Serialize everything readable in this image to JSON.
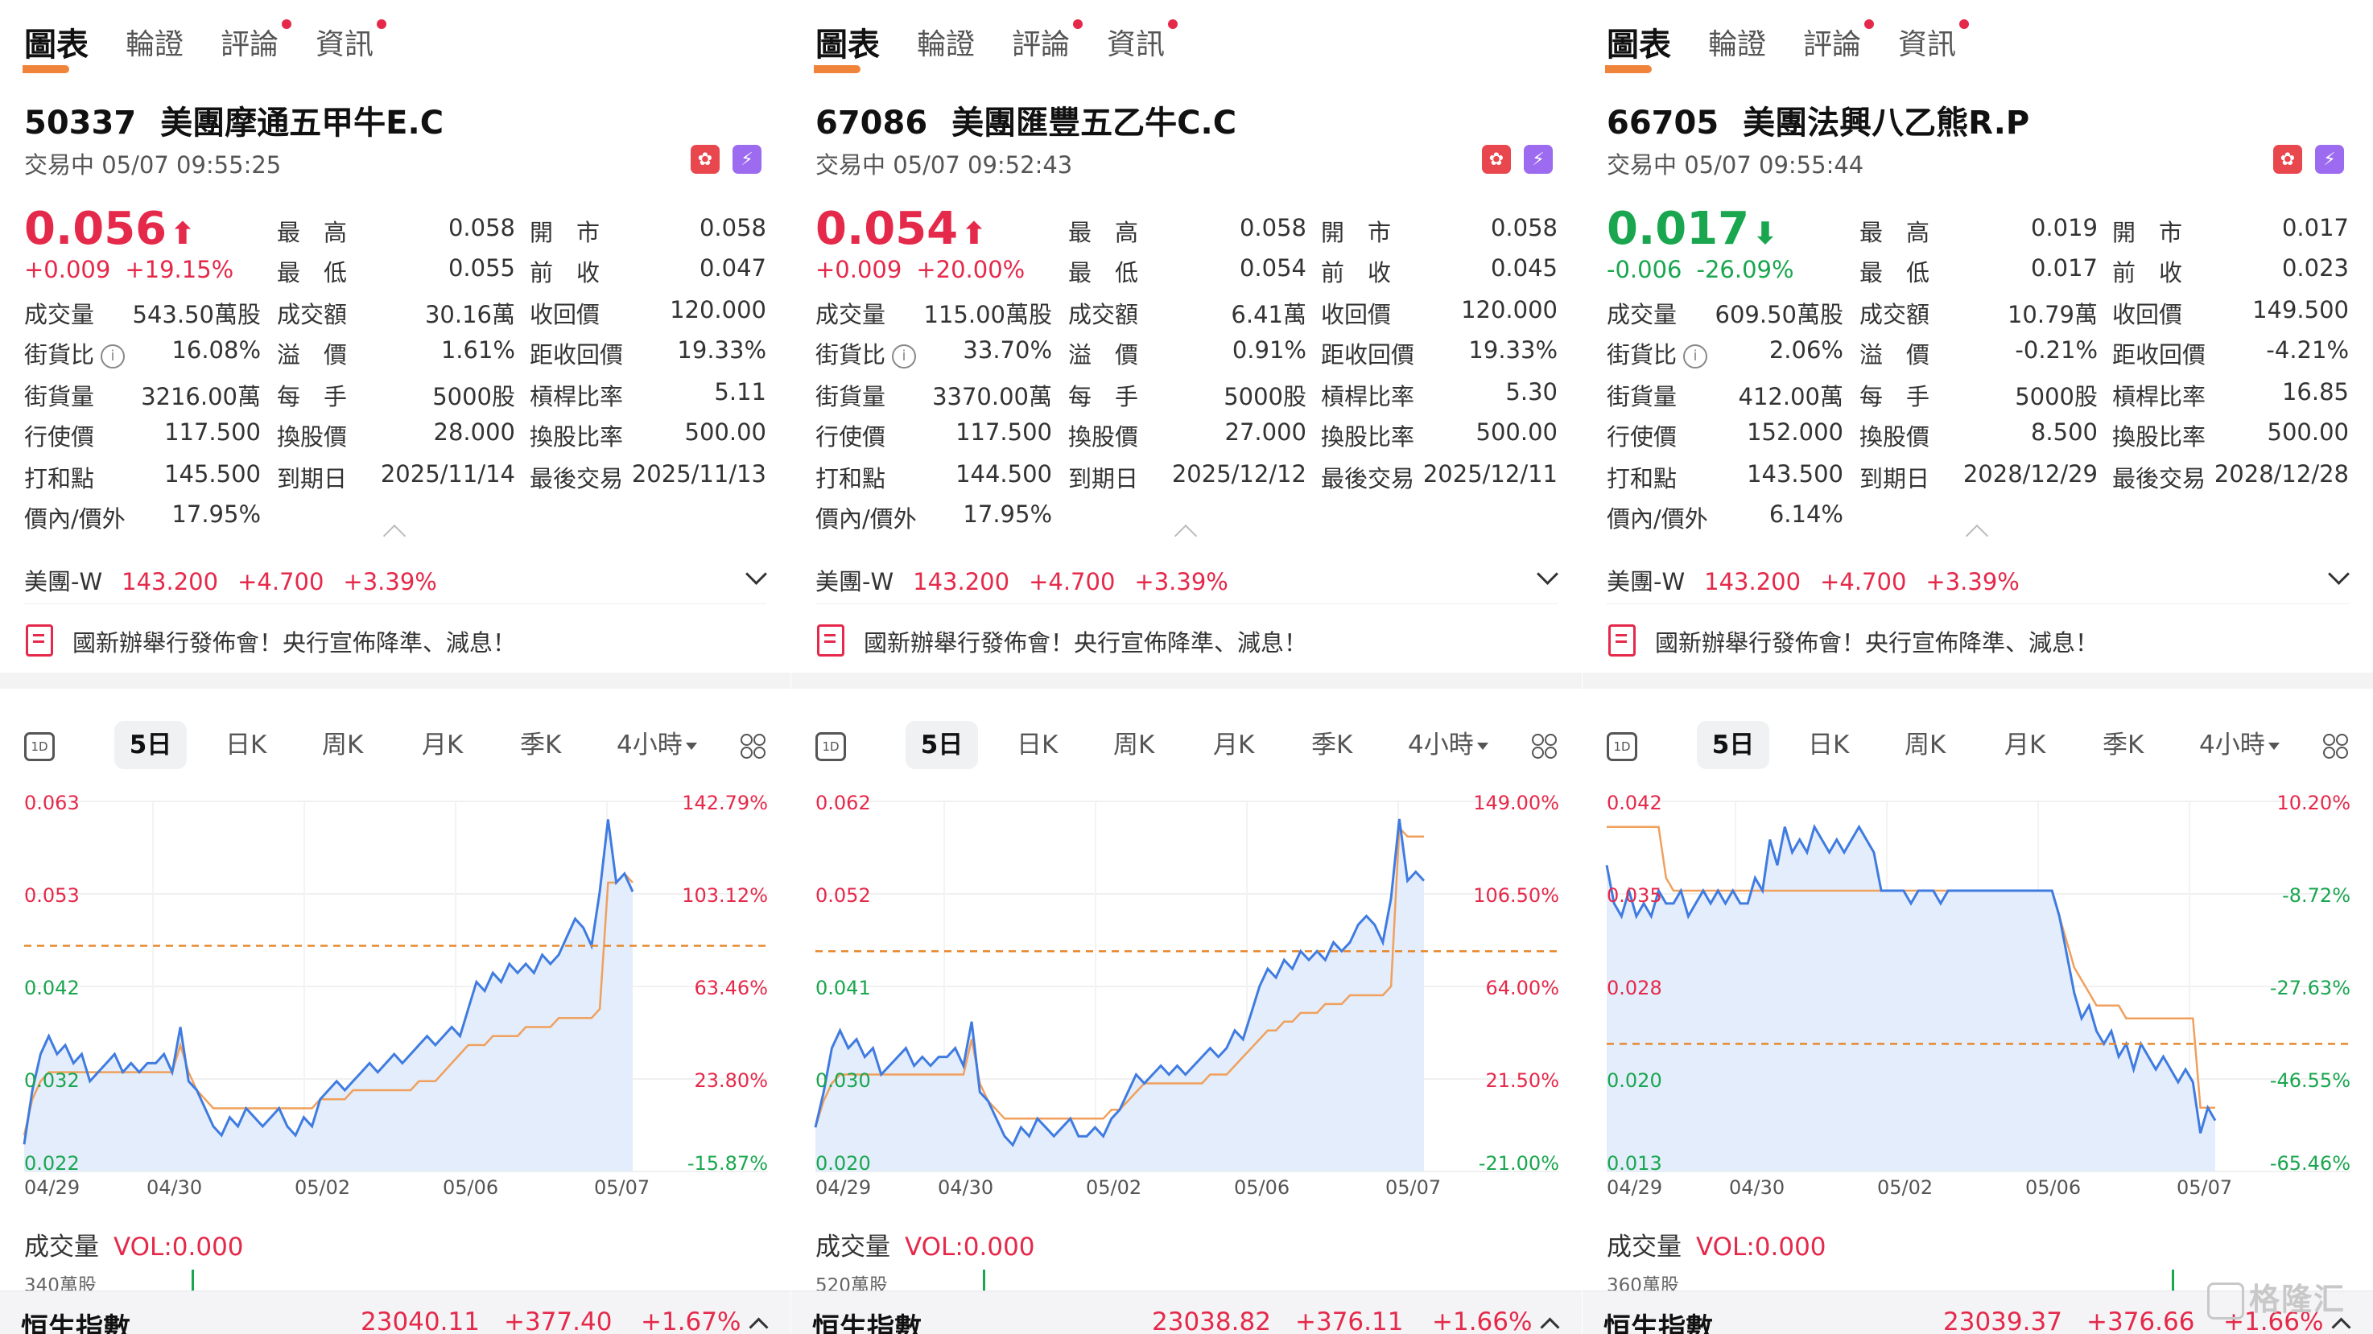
{
  "nav_tabs": [
    "圖表",
    "輪證",
    "評論",
    "資訊"
  ],
  "period_tabs": [
    "5日",
    "日K",
    "周K",
    "月K",
    "季K",
    "4小時"
  ],
  "day_icon_label": "1D",
  "underlying": {
    "name": "美團-W",
    "price": "143.200",
    "change": "+4.700",
    "pct": "+3.39%"
  },
  "news_text": "國新辦舉行發佈會！央行宣佈降準、減息！",
  "volume_label": "成交量",
  "volume_value": "VOL:0.000",
  "index": {
    "name": "恒生指數"
  },
  "watermark": "格隆汇",
  "x_axis_labels": [
    "04/29",
    "04/30",
    "05/02",
    "05/06",
    "05/07"
  ],
  "row_labels": [
    "成交量",
    "街貨比",
    "街貨量",
    "行使價",
    "打和點",
    "價內/價外"
  ],
  "mid_labels": [
    "最　高",
    "最　低",
    "成交額",
    "溢　價",
    "每　手",
    "換股價",
    "到期日"
  ],
  "right_labels": [
    "開　市",
    "前　收",
    "收回價",
    "距收回價",
    "槓桿比率",
    "換股比率",
    "最後交易"
  ],
  "panels": [
    {
      "code": "50337",
      "name": "美團摩通五甲牛E.C",
      "status": "交易中 05/07 09:55:25",
      "price": "0.056",
      "arrow": "⬆",
      "direction": "up",
      "change": "+0.009",
      "change_pct": "+19.15%",
      "high": "0.058",
      "low": "0.055",
      "open": "0.058",
      "prev_close": "0.047",
      "volume": "543.50萬股",
      "turnover": "30.16萬",
      "call_price": "120.000",
      "outstanding_ratio": "16.08%",
      "premium": "1.61%",
      "to_call": "19.33%",
      "outstanding_qty": "3216.00萬",
      "lot": "5000股",
      "leverage": "5.11",
      "strike": "117.500",
      "conv_price": "28.000",
      "conv_ratio": "500.00",
      "breakeven": "145.500",
      "expiry": "2025/11/14",
      "last_trade": "2025/11/13",
      "moneyness": "17.95%",
      "vol_scale": "340萬股",
      "index_value": "23040.11",
      "index_change": "+377.40",
      "index_pct": "+1.67%",
      "chart_data": {
        "type": "line",
        "y_left_labels": [
          "0.063",
          "0.053",
          "0.042",
          "0.032",
          "0.022"
        ],
        "y_right_labels": [
          "142.79%",
          "103.12%",
          "63.46%",
          "23.80%",
          "-15.87%"
        ],
        "ylim": [
          0.022,
          0.063
        ],
        "prev_close": 0.047,
        "price": [
          0.025,
          0.031,
          0.035,
          0.037,
          0.035,
          0.036,
          0.034,
          0.035,
          0.032,
          0.033,
          0.034,
          0.035,
          0.033,
          0.034,
          0.033,
          0.034,
          0.034,
          0.035,
          0.033,
          0.038,
          0.032,
          0.031,
          0.029,
          0.027,
          0.026,
          0.028,
          0.027,
          0.029,
          0.028,
          0.027,
          0.028,
          0.029,
          0.027,
          0.026,
          0.028,
          0.027,
          0.03,
          0.031,
          0.032,
          0.031,
          0.032,
          0.033,
          0.034,
          0.033,
          0.034,
          0.035,
          0.034,
          0.035,
          0.036,
          0.037,
          0.036,
          0.037,
          0.038,
          0.037,
          0.04,
          0.043,
          0.042,
          0.044,
          0.043,
          0.045,
          0.044,
          0.045,
          0.044,
          0.046,
          0.045,
          0.046,
          0.048,
          0.05,
          0.049,
          0.047,
          0.053,
          0.061,
          0.054,
          0.055,
          0.053
        ],
        "avg": [
          0.026,
          0.03,
          0.032,
          0.033,
          0.033,
          0.033,
          0.033,
          0.033,
          0.033,
          0.033,
          0.033,
          0.033,
          0.033,
          0.033,
          0.033,
          0.033,
          0.033,
          0.033,
          0.033,
          0.036,
          0.033,
          0.031,
          0.03,
          0.029,
          0.029,
          0.029,
          0.029,
          0.029,
          0.029,
          0.029,
          0.029,
          0.029,
          0.029,
          0.029,
          0.029,
          0.029,
          0.03,
          0.03,
          0.03,
          0.03,
          0.031,
          0.031,
          0.031,
          0.031,
          0.031,
          0.031,
          0.031,
          0.031,
          0.032,
          0.032,
          0.032,
          0.033,
          0.034,
          0.035,
          0.036,
          0.036,
          0.036,
          0.037,
          0.037,
          0.037,
          0.037,
          0.038,
          0.038,
          0.038,
          0.038,
          0.039,
          0.039,
          0.039,
          0.039,
          0.039,
          0.04,
          0.054,
          0.054,
          0.055,
          0.054
        ]
      }
    },
    {
      "code": "67086",
      "name": "美團匯豐五乙牛C.C",
      "status": "交易中 05/07 09:52:43",
      "price": "0.054",
      "arrow": "⬆",
      "direction": "up",
      "change": "+0.009",
      "change_pct": "+20.00%",
      "high": "0.058",
      "low": "0.054",
      "open": "0.058",
      "prev_close": "0.045",
      "volume": "115.00萬股",
      "turnover": "6.41萬",
      "call_price": "120.000",
      "outstanding_ratio": "33.70%",
      "premium": "0.91%",
      "to_call": "19.33%",
      "outstanding_qty": "3370.00萬",
      "lot": "5000股",
      "leverage": "5.30",
      "strike": "117.500",
      "conv_price": "27.000",
      "conv_ratio": "500.00",
      "breakeven": "144.500",
      "expiry": "2025/12/12",
      "last_trade": "2025/12/11",
      "moneyness": "17.95%",
      "vol_scale": "520萬股",
      "index_value": "23038.82",
      "index_change": "+376.11",
      "index_pct": "+1.66%",
      "chart_data": {
        "type": "line",
        "y_left_labels": [
          "0.062",
          "0.052",
          "0.041",
          "0.030",
          "0.020"
        ],
        "y_right_labels": [
          "149.00%",
          "106.50%",
          "64.00%",
          "21.50%",
          "-21.00%"
        ],
        "ylim": [
          0.02,
          0.062
        ],
        "prev_close": 0.045,
        "price": [
          0.025,
          0.029,
          0.034,
          0.036,
          0.034,
          0.035,
          0.033,
          0.034,
          0.031,
          0.032,
          0.033,
          0.034,
          0.032,
          0.033,
          0.032,
          0.033,
          0.033,
          0.034,
          0.032,
          0.037,
          0.029,
          0.028,
          0.026,
          0.024,
          0.023,
          0.025,
          0.024,
          0.026,
          0.025,
          0.024,
          0.025,
          0.026,
          0.024,
          0.024,
          0.025,
          0.024,
          0.026,
          0.027,
          0.029,
          0.031,
          0.03,
          0.031,
          0.032,
          0.031,
          0.032,
          0.031,
          0.032,
          0.033,
          0.034,
          0.033,
          0.034,
          0.036,
          0.035,
          0.038,
          0.041,
          0.043,
          0.042,
          0.044,
          0.043,
          0.045,
          0.044,
          0.045,
          0.044,
          0.046,
          0.045,
          0.046,
          0.048,
          0.049,
          0.048,
          0.046,
          0.051,
          0.06,
          0.053,
          0.054,
          0.053
        ],
        "avg": [
          0.025,
          0.028,
          0.03,
          0.031,
          0.031,
          0.031,
          0.031,
          0.031,
          0.031,
          0.031,
          0.031,
          0.031,
          0.031,
          0.031,
          0.031,
          0.031,
          0.031,
          0.031,
          0.031,
          0.035,
          0.03,
          0.028,
          0.027,
          0.026,
          0.026,
          0.026,
          0.026,
          0.026,
          0.026,
          0.026,
          0.026,
          0.026,
          0.026,
          0.026,
          0.026,
          0.026,
          0.027,
          0.027,
          0.028,
          0.029,
          0.03,
          0.03,
          0.03,
          0.03,
          0.03,
          0.03,
          0.03,
          0.03,
          0.031,
          0.031,
          0.031,
          0.032,
          0.033,
          0.034,
          0.035,
          0.036,
          0.036,
          0.037,
          0.037,
          0.038,
          0.038,
          0.038,
          0.039,
          0.039,
          0.039,
          0.04,
          0.04,
          0.04,
          0.04,
          0.04,
          0.041,
          0.059,
          0.058,
          0.058,
          0.058
        ]
      }
    },
    {
      "code": "66705",
      "name": "美團法興八乙熊R.P",
      "status": "交易中 05/07 09:55:44",
      "price": "0.017",
      "arrow": "⬇",
      "direction": "down",
      "change": "-0.006",
      "change_pct": "-26.09%",
      "high": "0.019",
      "low": "0.017",
      "open": "0.017",
      "prev_close": "0.023",
      "volume": "609.50萬股",
      "turnover": "10.79萬",
      "call_price": "149.500",
      "outstanding_ratio": "2.06%",
      "premium": "-0.21%",
      "to_call": "-4.21%",
      "outstanding_qty": "412.00萬",
      "lot": "5000股",
      "leverage": "16.85",
      "strike": "152.000",
      "conv_price": "8.500",
      "conv_ratio": "500.00",
      "breakeven": "143.500",
      "expiry": "2028/12/29",
      "last_trade": "2028/12/28",
      "moneyness": "6.14%",
      "vol_scale": "360萬股",
      "index_value": "23039.37",
      "index_change": "+376.66",
      "index_pct": "+1.66%",
      "chart_data": {
        "type": "line",
        "y_left_labels": [
          "0.042",
          "0.035",
          "0.028",
          "0.020",
          "0.013"
        ],
        "y_right_labels": [
          "10.20%",
          "-8.72%",
          "-27.63%",
          "-46.55%",
          "-65.46%"
        ],
        "ylim": [
          0.013,
          0.042
        ],
        "prev_close": 0.023,
        "price": [
          0.037,
          0.034,
          0.033,
          0.035,
          0.033,
          0.034,
          0.033,
          0.035,
          0.034,
          0.034,
          0.035,
          0.033,
          0.034,
          0.035,
          0.034,
          0.035,
          0.034,
          0.035,
          0.034,
          0.034,
          0.036,
          0.035,
          0.039,
          0.037,
          0.04,
          0.038,
          0.039,
          0.038,
          0.04,
          0.039,
          0.038,
          0.039,
          0.038,
          0.039,
          0.04,
          0.039,
          0.038,
          0.035,
          0.035,
          0.035,
          0.035,
          0.034,
          0.035,
          0.035,
          0.035,
          0.034,
          0.035,
          0.035,
          0.035,
          0.035,
          0.035,
          0.035,
          0.035,
          0.035,
          0.035,
          0.035,
          0.035,
          0.035,
          0.035,
          0.035,
          0.035,
          0.033,
          0.03,
          0.027,
          0.025,
          0.026,
          0.024,
          0.023,
          0.024,
          0.022,
          0.023,
          0.021,
          0.023,
          0.022,
          0.021,
          0.022,
          0.021,
          0.02,
          0.021,
          0.02,
          0.016,
          0.018,
          0.017
        ],
        "avg": [
          0.04,
          0.04,
          0.04,
          0.04,
          0.04,
          0.04,
          0.04,
          0.04,
          0.036,
          0.035,
          0.035,
          0.035,
          0.035,
          0.035,
          0.035,
          0.035,
          0.035,
          0.035,
          0.035,
          0.035,
          0.035,
          0.035,
          0.035,
          0.035,
          0.035,
          0.035,
          0.035,
          0.035,
          0.035,
          0.035,
          0.035,
          0.035,
          0.035,
          0.035,
          0.035,
          0.035,
          0.035,
          0.035,
          0.035,
          0.035,
          0.035,
          0.035,
          0.035,
          0.035,
          0.035,
          0.035,
          0.035,
          0.035,
          0.035,
          0.035,
          0.035,
          0.035,
          0.035,
          0.035,
          0.035,
          0.035,
          0.035,
          0.035,
          0.035,
          0.035,
          0.035,
          0.033,
          0.031,
          0.029,
          0.028,
          0.027,
          0.026,
          0.026,
          0.026,
          0.026,
          0.025,
          0.025,
          0.025,
          0.025,
          0.025,
          0.025,
          0.025,
          0.025,
          0.025,
          0.025,
          0.018,
          0.018,
          0.018
        ]
      }
    }
  ]
}
